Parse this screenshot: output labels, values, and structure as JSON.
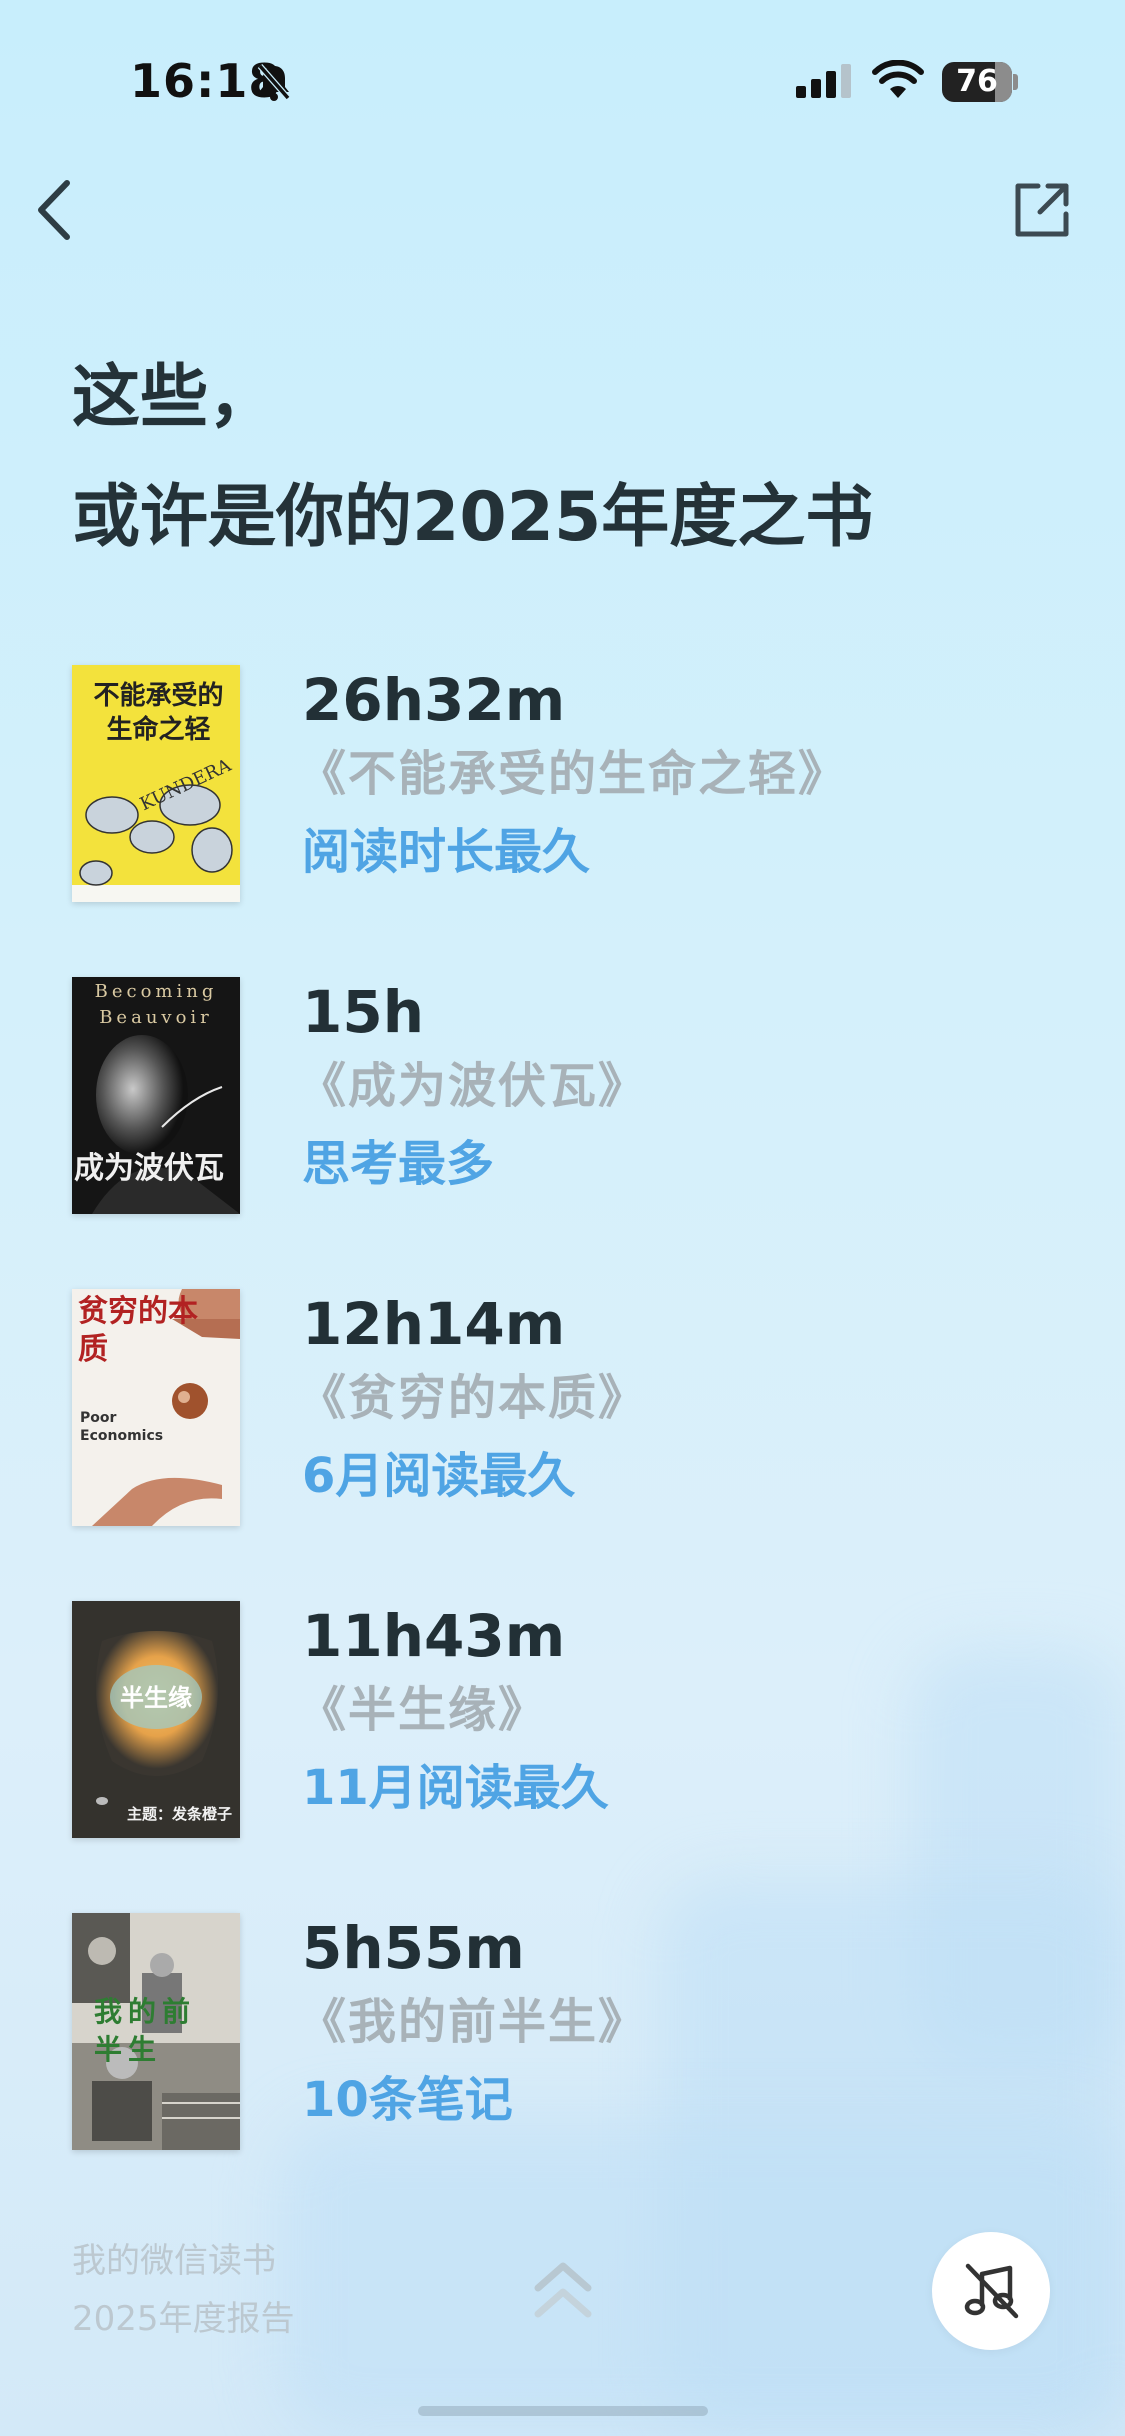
{
  "status_bar": {
    "time": "16:18",
    "battery": "76",
    "battery_level": 0.76,
    "icons": [
      "bell-muted-icon",
      "signal-icon",
      "wifi-icon",
      "battery-icon"
    ]
  },
  "nav": {
    "back_icon": "chevron-left-icon",
    "share_icon": "share-external-icon"
  },
  "heading": {
    "line1": "这些，",
    "line2": "或许是你的2025年度之书"
  },
  "books": [
    {
      "metric": "26h32m",
      "title": "《不能承受的生命之轻》",
      "caption": "阅读时长最久",
      "cover_text": "不能承受的生命之轻",
      "cover_subtext": "KUNDERA"
    },
    {
      "metric": "15h",
      "title": "《成为波伏瓦》",
      "caption": "思考最多",
      "cover_text": "成为波伏瓦",
      "cover_subtext": "Becoming Beauvoir"
    },
    {
      "metric": "12h14m",
      "title": "《贫穷的本质》",
      "caption": "6月阅读最久",
      "cover_text": "贫穷的本质",
      "cover_subtext": "Poor Economics"
    },
    {
      "metric": "11h43m",
      "title": "《半生缘》",
      "caption": "11月阅读最久",
      "cover_text": "半生缘",
      "cover_subtext": "主题：发条橙子"
    },
    {
      "metric": "5h55m",
      "title": "《我的前半生》",
      "caption": "10条笔记",
      "cover_text": "我的前半生",
      "cover_subtext": ""
    }
  ],
  "footer": {
    "line1": "我的微信读书",
    "line2": "2025年度报告",
    "up_icon": "double-chevron-up-icon",
    "music_icon": "music-off-icon"
  },
  "colors": {
    "accent": "#4fa4e4",
    "heading": "#243238",
    "title_gray": "#a8b2b8"
  }
}
